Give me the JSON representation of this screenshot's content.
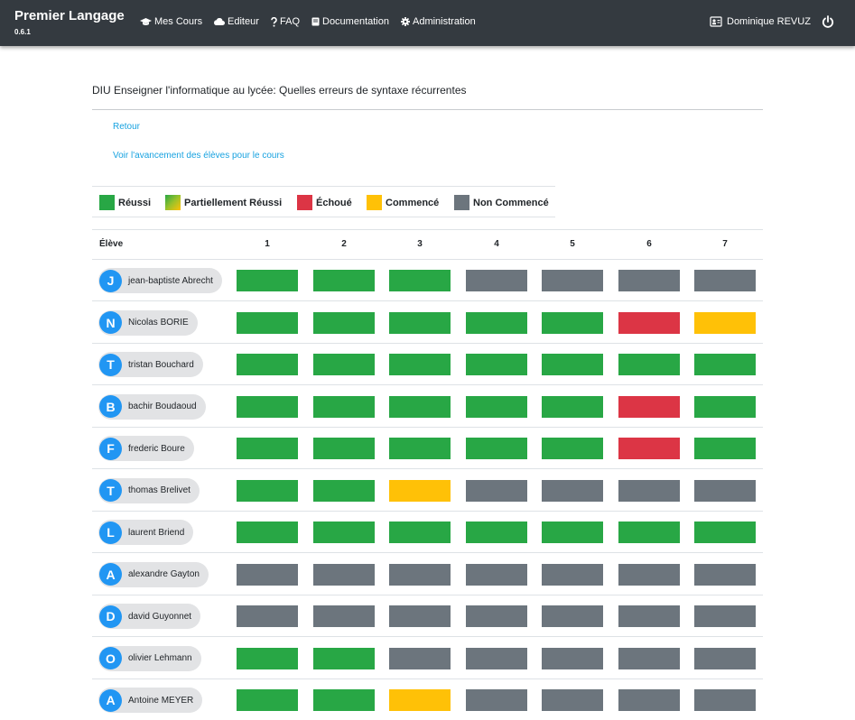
{
  "app": {
    "brand": "Premier Langage",
    "version": "0.6.1"
  },
  "nav": {
    "items": [
      {
        "label": "Mes Cours",
        "icon": "graduation-cap-icon"
      },
      {
        "label": "Editeur",
        "icon": "cloud-icon"
      },
      {
        "label": "FAQ",
        "icon": "question-icon"
      },
      {
        "label": "Documentation",
        "icon": "book-icon"
      },
      {
        "label": "Administration",
        "icon": "cog-icon"
      }
    ],
    "user": {
      "name": "Dominique REVUZ",
      "icon": "id-card-icon"
    },
    "logout_icon": "power-icon"
  },
  "course": {
    "title": "DIU Enseigner l'informatique au lycée: Quelles erreurs de syntaxe récurrentes",
    "back_link": "Retour",
    "progress_link": "Voir l'avancement des élèves pour le cours"
  },
  "legend": [
    {
      "label": "Réussi",
      "status": "success",
      "color": "#28a745"
    },
    {
      "label": "Partiellement Réussi",
      "status": "partial",
      "color": "#9bc22a"
    },
    {
      "label": "Échoué",
      "status": "failed",
      "color": "#dc3545"
    },
    {
      "label": "Commencé",
      "status": "started",
      "color": "#ffc107"
    },
    {
      "label": "Non Commencé",
      "status": "not-started",
      "color": "#6c757d"
    }
  ],
  "table": {
    "student_header": "Élève",
    "columns": [
      "1",
      "2",
      "3",
      "4",
      "5",
      "6",
      "7"
    ],
    "rows": [
      {
        "initial": "J",
        "name": "jean-baptiste Abrecht",
        "cells": [
          "success",
          "success",
          "success",
          "not-started",
          "not-started",
          "not-started",
          "not-started"
        ]
      },
      {
        "initial": "N",
        "name": "Nicolas BORIE",
        "cells": [
          "success",
          "success",
          "success",
          "success",
          "success",
          "failed",
          "started"
        ]
      },
      {
        "initial": "T",
        "name": "tristan Bouchard",
        "cells": [
          "success",
          "success",
          "success",
          "success",
          "success",
          "success",
          "success"
        ]
      },
      {
        "initial": "B",
        "name": "bachir Boudaoud",
        "cells": [
          "success",
          "success",
          "success",
          "success",
          "success",
          "failed",
          "success"
        ]
      },
      {
        "initial": "F",
        "name": "frederic Boure",
        "cells": [
          "success",
          "success",
          "success",
          "success",
          "success",
          "failed",
          "success"
        ]
      },
      {
        "initial": "T",
        "name": "thomas Brelivet",
        "cells": [
          "success",
          "success",
          "started",
          "not-started",
          "not-started",
          "not-started",
          "not-started"
        ]
      },
      {
        "initial": "L",
        "name": "laurent Briend",
        "cells": [
          "success",
          "success",
          "success",
          "success",
          "success",
          "success",
          "success"
        ]
      },
      {
        "initial": "A",
        "name": "alexandre Gayton",
        "cells": [
          "not-started",
          "not-started",
          "not-started",
          "not-started",
          "not-started",
          "not-started",
          "not-started"
        ]
      },
      {
        "initial": "D",
        "name": "david Guyonnet",
        "cells": [
          "not-started",
          "not-started",
          "not-started",
          "not-started",
          "not-started",
          "not-started",
          "not-started"
        ]
      },
      {
        "initial": "O",
        "name": "olivier Lehmann",
        "cells": [
          "success",
          "success",
          "not-started",
          "not-started",
          "not-started",
          "not-started",
          "not-started"
        ]
      },
      {
        "initial": "A",
        "name": "Antoine MEYER",
        "cells": [
          "success",
          "success",
          "started",
          "not-started",
          "not-started",
          "not-started",
          "not-started"
        ]
      }
    ]
  }
}
